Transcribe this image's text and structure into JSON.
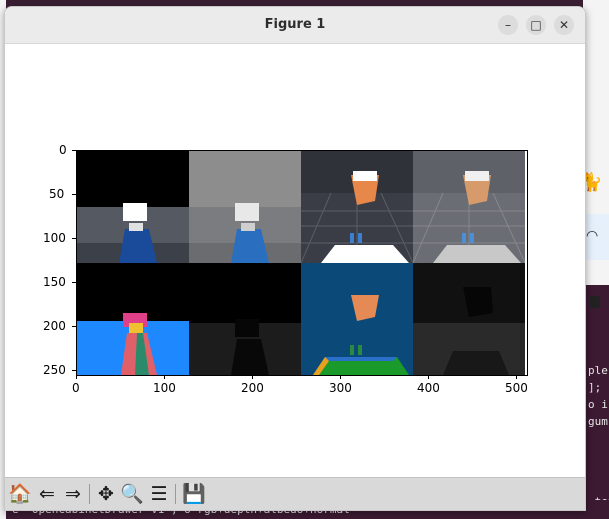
{
  "window": {
    "title": "Figure 1",
    "minimize": "–",
    "maximize": "□",
    "close": "✕"
  },
  "plot": {
    "y_ticks": [
      "0",
      "50",
      "100",
      "150",
      "200",
      "250"
    ],
    "x_ticks": [
      "0",
      "100",
      "200",
      "300",
      "400",
      "500"
    ]
  },
  "toolbar": {
    "home": "🏠",
    "back": "⇐",
    "forward": "⇒",
    "pan": "✥",
    "zoom": "🔍",
    "configure": "☰",
    "save": "💾"
  },
  "terminal": {
    "bottom_line": "e \"OpenCabinetDrawer-v1\", o rgb+depth+albedo+normal",
    "right_lines": [
      "ple",
      "];",
      "o i",
      "gum",
      "_tex"
    ]
  }
}
